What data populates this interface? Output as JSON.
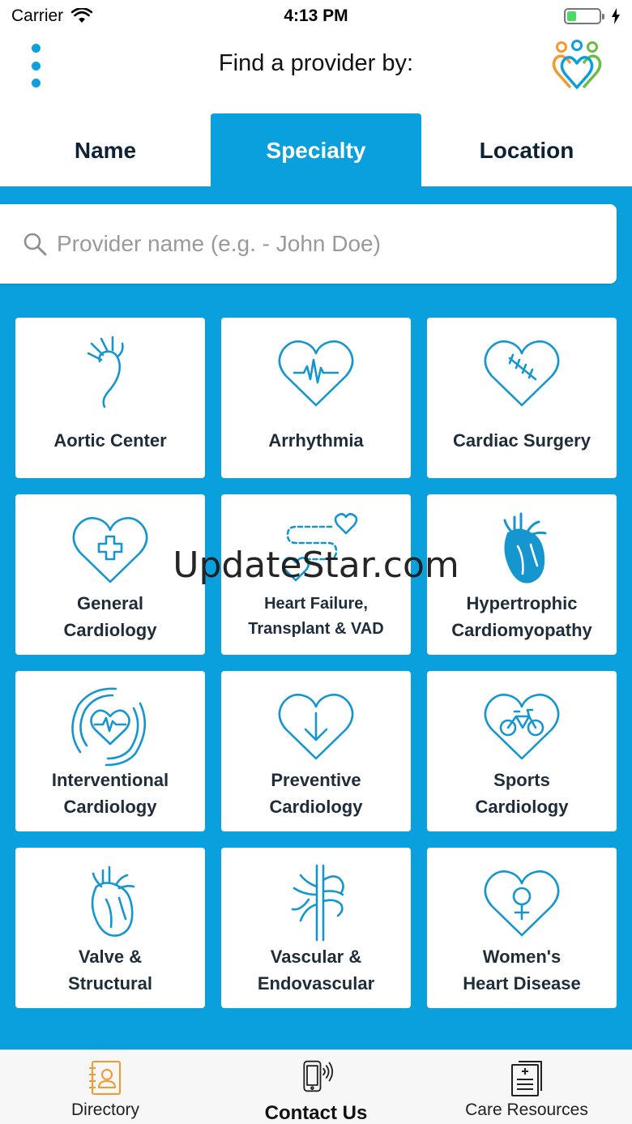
{
  "status_bar": {
    "carrier": "Carrier",
    "time": "4:13 PM",
    "battery_level": 0.3
  },
  "header": {
    "title": "Find a provider by:",
    "menu_icon": "vertical-dots-icon",
    "logo_icon": "people-hearts-logo"
  },
  "tabs": [
    {
      "label": "Name",
      "active": false
    },
    {
      "label": "Specialty",
      "active": true
    },
    {
      "label": "Location",
      "active": false
    }
  ],
  "search": {
    "placeholder": "Provider name (e.g. - John Doe)",
    "value": ""
  },
  "specialties": [
    {
      "label": "Aortic Center",
      "icon": "aorta-icon"
    },
    {
      "label": "Arrhythmia",
      "icon": "heart-ecg-icon"
    },
    {
      "label": "Cardiac Surgery",
      "icon": "heart-stitches-icon"
    },
    {
      "label": "General\nCardiology",
      "icon": "heart-cross-icon"
    },
    {
      "label": "Heart Failure,\nTransplant & VAD",
      "icon": "heart-transplant-icon"
    },
    {
      "label": "Hypertrophic\nCardiomyopathy",
      "icon": "anatomical-heart-filled-icon"
    },
    {
      "label": "Interventional\nCardiology",
      "icon": "heart-pulse-waves-icon"
    },
    {
      "label": "Preventive\nCardiology",
      "icon": "heart-arrow-down-icon"
    },
    {
      "label": "Sports\nCardiology",
      "icon": "heart-bicycle-icon"
    },
    {
      "label": "Valve &\nStructural",
      "icon": "anatomical-heart-outline-icon"
    },
    {
      "label": "Vascular &\nEndovascular",
      "icon": "vascular-tree-icon"
    },
    {
      "label": "Women's\nHeart Disease",
      "icon": "heart-female-icon"
    }
  ],
  "watermark": "UpdateStar.com",
  "bottom_nav": [
    {
      "label": "Directory",
      "icon": "directory-contact-card-icon",
      "active": false
    },
    {
      "label": "Contact Us",
      "icon": "phone-ringing-icon",
      "active": true
    },
    {
      "label": "Care Resources",
      "icon": "documents-icon",
      "active": false
    }
  ],
  "colors": {
    "brand_blue": "#0aa0de",
    "text_dark": "#1f2d3b",
    "icon_orange": "#f29a2e"
  }
}
